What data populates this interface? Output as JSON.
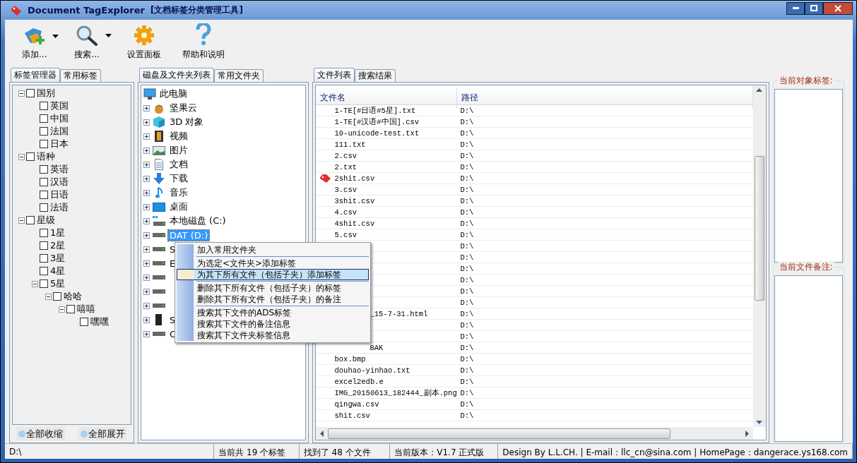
{
  "window": {
    "title": "Document TagExplorer",
    "subtitle": "[文档标签分类管理工具]"
  },
  "toolbar": [
    {
      "label": "添加...",
      "dropdown": true
    },
    {
      "label": "搜索...",
      "dropdown": true
    },
    {
      "label": "设置面板",
      "dropdown": false
    },
    {
      "label": "帮助和说明",
      "dropdown": false
    }
  ],
  "left_tabs": [
    {
      "label": "标签管理器",
      "selected": true
    },
    {
      "label": "常用标签",
      "selected": false
    }
  ],
  "tag_tree": [
    {
      "label": "国别",
      "checked": false,
      "expanded": true,
      "children": [
        {
          "label": "英国",
          "checked": false
        },
        {
          "label": "中国",
          "checked": false
        },
        {
          "label": "法国",
          "checked": false
        },
        {
          "label": "日本",
          "checked": false
        }
      ]
    },
    {
      "label": "语种",
      "checked": false,
      "expanded": true,
      "children": [
        {
          "label": "英语",
          "checked": false
        },
        {
          "label": "汉语",
          "checked": false
        },
        {
          "label": "日语",
          "checked": false
        },
        {
          "label": "法语",
          "checked": false
        }
      ]
    },
    {
      "label": "星级",
      "checked": false,
      "expanded": true,
      "children": [
        {
          "label": "1星",
          "checked": false
        },
        {
          "label": "2星",
          "checked": false
        },
        {
          "label": "3星",
          "checked": false
        },
        {
          "label": "4星",
          "checked": false
        },
        {
          "label": "5星",
          "checked": false,
          "expanded": true,
          "children": [
            {
              "label": "哈哈",
              "checked": false,
              "expanded": true,
              "children": [
                {
                  "label": "嘻嘻",
                  "checked": false,
                  "expanded": true,
                  "children": [
                    {
                      "label": "嘿嘿",
                      "checked": false
                    }
                  ]
                }
              ]
            }
          ]
        }
      ]
    }
  ],
  "tag_buttons": [
    "全部收缩",
    "全部展开"
  ],
  "middle_tabs": [
    {
      "label": "磁盘及文件夹列表",
      "selected": true
    },
    {
      "label": "常用文件夹",
      "selected": false
    }
  ],
  "folder_tree": {
    "root": {
      "label": "此电脑",
      "kind": "computer"
    },
    "items": [
      {
        "label": "坚果云",
        "kind": "nut",
        "selected": false
      },
      {
        "label": "3D 对象",
        "kind": "cube",
        "selected": false
      },
      {
        "label": "视频",
        "kind": "video",
        "selected": false
      },
      {
        "label": "图片",
        "kind": "picture",
        "selected": false
      },
      {
        "label": "文档",
        "kind": "document",
        "selected": false
      },
      {
        "label": "下载",
        "kind": "download",
        "selected": false
      },
      {
        "label": "音乐",
        "kind": "music",
        "selected": false
      },
      {
        "label": "桌面",
        "kind": "desktop",
        "selected": false
      },
      {
        "label": "本地磁盘 (C:)",
        "kind": "system-drive",
        "selected": false
      },
      {
        "label": "DAT (D:)",
        "kind": "drive",
        "selected": true
      },
      {
        "label": "S",
        "kind": "drive",
        "selected": false
      },
      {
        "label": "E",
        "kind": "drive",
        "selected": false
      },
      {
        "kind": "drive",
        "selected": false
      },
      {
        "kind": "drive",
        "selected": false
      },
      {
        "kind": "drive",
        "selected": false
      },
      {
        "label": "S",
        "kind": "device",
        "selected": false
      },
      {
        "label": "C",
        "kind": "drive",
        "selected": false
      }
    ]
  },
  "context_menu": {
    "groups": [
      [
        {
          "label": "加入常用文件夹",
          "selected": false
        }
      ],
      [
        {
          "label": "为选定<文件夹>添加标签",
          "selected": false
        },
        {
          "label": "为其下所有文件（包括子夹）添加标签",
          "selected": true
        }
      ],
      [
        {
          "label": "删除其下所有文件（包括子夹）的标签",
          "selected": false
        },
        {
          "label": "删除其下所有文件（包括子夹）的备注",
          "selected": false
        }
      ],
      [
        {
          "label": "搜索其下文件的ADS标签",
          "selected": false
        },
        {
          "label": "搜索其下文件的备注信息",
          "selected": false
        },
        {
          "label": "搜索其下文件夹标签信息",
          "selected": false
        }
      ]
    ]
  },
  "file_tabs": [
    {
      "label": "文件列表",
      "selected": true
    },
    {
      "label": "搜索结果",
      "selected": false
    }
  ],
  "file_table": {
    "columns": [
      "文件名",
      "路径"
    ],
    "rows": [
      {
        "name": "1-TE[#日语#5星].txt",
        "path": "D:\\",
        "tagged": false
      },
      {
        "name": "1-TE[#汉语#中国].csv",
        "path": "D:\\",
        "tagged": false
      },
      {
        "name": "10-unicode-test.txt",
        "path": "D:\\",
        "tagged": false
      },
      {
        "name": "111.txt",
        "path": "D:\\",
        "tagged": false
      },
      {
        "name": "2.csv",
        "path": "D:\\",
        "tagged": false
      },
      {
        "name": "2.txt",
        "path": "D:\\",
        "tagged": false
      },
      {
        "name": "2shit.csv",
        "path": "D:\\",
        "tagged": true
      },
      {
        "name": "3.csv",
        "path": "D:\\",
        "tagged": false
      },
      {
        "name": "3shit.csv",
        "path": "D:\\",
        "tagged": false
      },
      {
        "name": "4.csv",
        "path": "D:\\",
        "tagged": false
      },
      {
        "name": "4shit.csv",
        "path": "D:\\",
        "tagged": false
      },
      {
        "name": "5.csv",
        "path": "D:\\",
        "tagged": false
      },
      {
        "path": "D:\\",
        "tagged": false
      },
      {
        "path": "D:\\",
        "tagged": false
      },
      {
        "path": "D:\\",
        "tagged": false
      },
      {
        "path": "D:\\",
        "tagged": false
      },
      {
        "path": "D:\\",
        "tagged": false
      },
      {
        "path": "D:\\",
        "tagged": false
      },
      {
        "name": "_15-7-31.html",
        "path": "D:\\",
        "tagged": false
      },
      {
        "path": "D:\\",
        "tagged": false
      },
      {
        "path": "D:\\",
        "tagged": false
      },
      {
        "name": "BAK",
        "path": "D:\\",
        "tagged": false
      },
      {
        "name": "box.bmp",
        "path": "D:\\",
        "tagged": false
      },
      {
        "name": "douhao-yinhao.txt",
        "path": "D:\\",
        "tagged": false
      },
      {
        "name": "excel2edb.e",
        "path": "D:\\",
        "tagged": false
      },
      {
        "name": "IMG_20150613_182444_副本.png",
        "path": "D:\\",
        "tagged": false
      },
      {
        "name": "qingwa.csv",
        "path": "D:\\",
        "tagged": false
      },
      {
        "name": "shit.csv",
        "path": "D:\\",
        "tagged": false
      }
    ]
  },
  "side_panels": [
    {
      "title": "当前对象标签:"
    },
    {
      "title": "当前文件备注:"
    }
  ],
  "status_bar": [
    "D:\\",
    "当前共 19 个标签",
    "找到了 48 个文件",
    "当前版本：V1.7 正式版",
    "Design By L.L.CH. | E-mail：llc_cn@sina.com | HomePage：dangerace.ys168.com"
  ]
}
